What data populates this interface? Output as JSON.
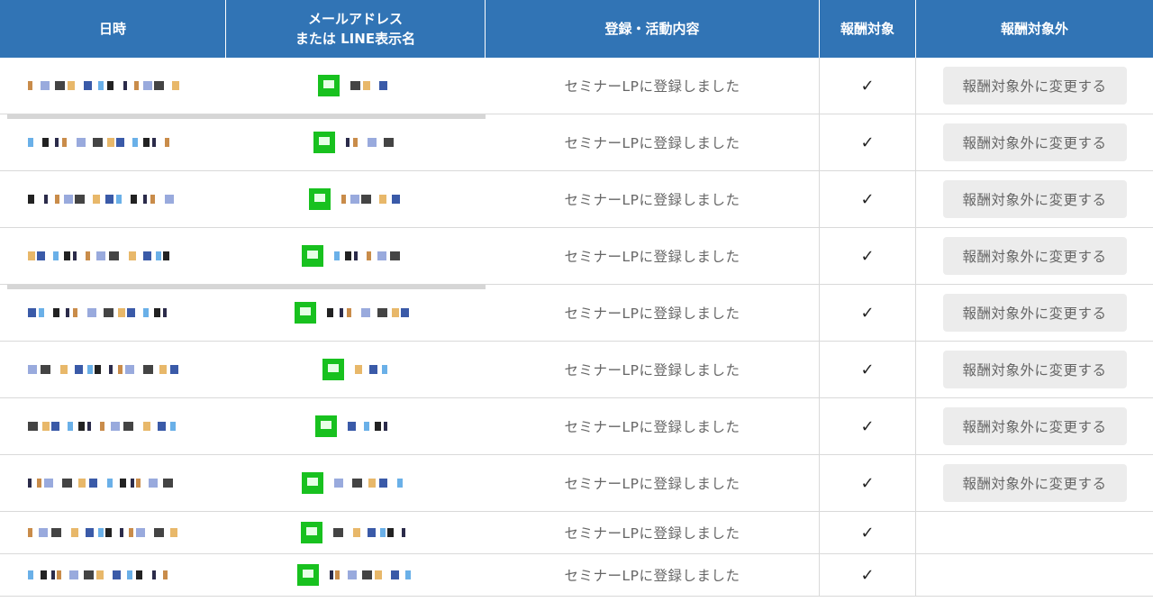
{
  "header": {
    "col_datetime": "日時",
    "col_contact_line1": "メールアドレス",
    "col_contact_line2": "または LINE表示名",
    "col_activity": "登録・活動内容",
    "col_reward": "報酬対象",
    "col_exclude": "報酬対象外"
  },
  "rows": [
    {
      "activity": "セミナーLPに登録しました",
      "reward_mark": "✓",
      "action_label": "報酬対象外に変更する"
    },
    {
      "activity": "セミナーLPに登録しました",
      "reward_mark": "✓",
      "action_label": "報酬対象外に変更する"
    },
    {
      "activity": "セミナーLPに登録しました",
      "reward_mark": "✓",
      "action_label": "報酬対象外に変更する"
    },
    {
      "activity": "セミナーLPに登録しました",
      "reward_mark": "✓",
      "action_label": "報酬対象外に変更する"
    },
    {
      "activity": "セミナーLPに登録しました",
      "reward_mark": "✓",
      "action_label": "報酬対象外に変更する"
    },
    {
      "activity": "セミナーLPに登録しました",
      "reward_mark": "✓",
      "action_label": "報酬対象外に変更する"
    },
    {
      "activity": "セミナーLPに登録しました",
      "reward_mark": "✓",
      "action_label": "報酬対象外に変更する"
    },
    {
      "activity": "セミナーLPに登録しました",
      "reward_mark": "✓",
      "action_label": "報酬対象外に変更する"
    },
    {
      "activity": "セミナーLPに登録しました",
      "reward_mark": "✓",
      "action_label": ""
    },
    {
      "activity": "セミナーLPに登録しました",
      "reward_mark": "✓",
      "action_label": ""
    }
  ],
  "colors": {
    "header_bg": "#3174b5",
    "line_green": "#18c11f",
    "button_bg": "#ececec"
  }
}
